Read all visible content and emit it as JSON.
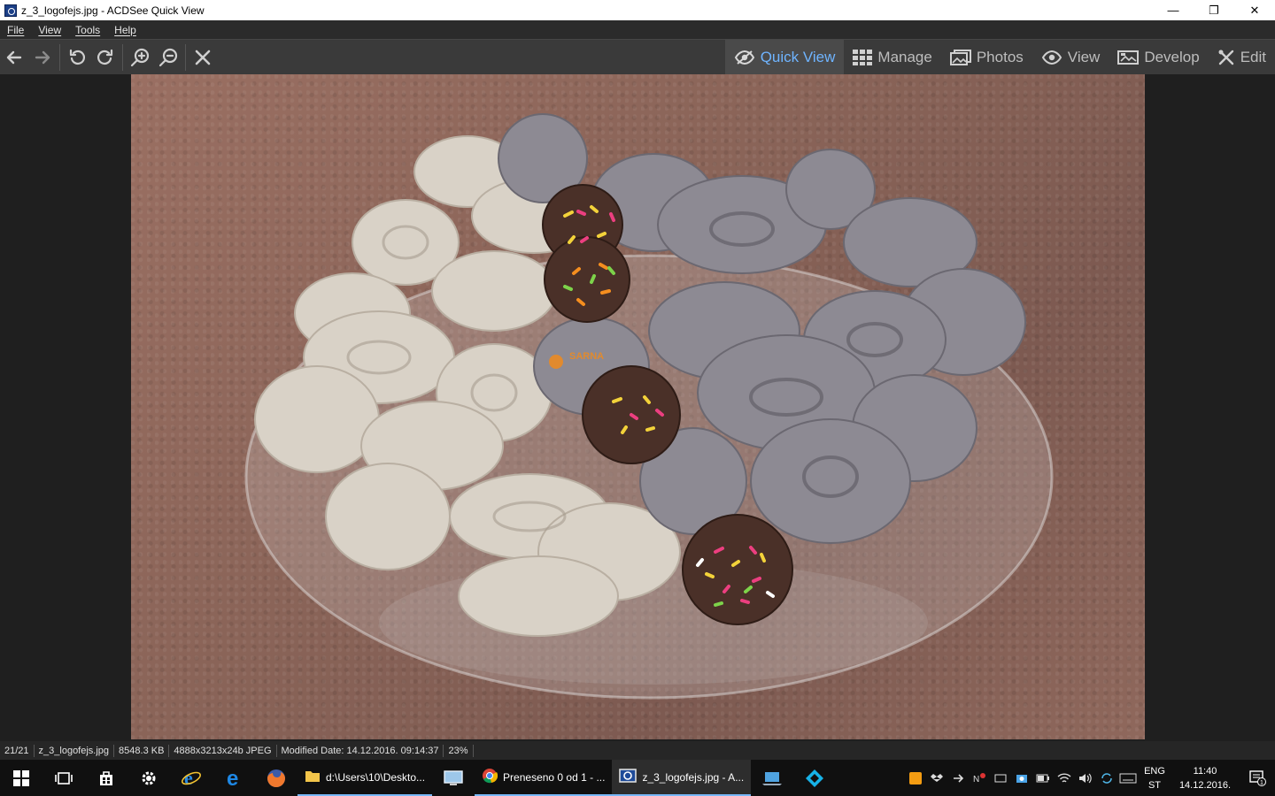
{
  "window": {
    "title": "z_3_logofejs.jpg - ACDSee Quick View",
    "controls": {
      "minimize": "—",
      "restore": "❐",
      "close": "✕"
    }
  },
  "menu": [
    "File",
    "View",
    "Tools",
    "Help"
  ],
  "toolbar": {
    "left_icons": [
      "back-arrow-icon",
      "forward-arrow-icon",
      "rotate-left-icon",
      "rotate-right-icon",
      "zoom-in-icon",
      "zoom-out-icon",
      "close-icon"
    ],
    "modes": [
      {
        "label": "Quick View",
        "icon": "eye-icon",
        "active": true
      },
      {
        "label": "Manage",
        "icon": "grid-icon",
        "active": false
      },
      {
        "label": "Photos",
        "icon": "photos-icon",
        "active": false
      },
      {
        "label": "View",
        "icon": "eye-icon",
        "active": false
      },
      {
        "label": "Develop",
        "icon": "develop-icon",
        "active": false
      },
      {
        "label": "Edit",
        "icon": "edit-icon",
        "active": false
      }
    ]
  },
  "image": {
    "description_icon": "cookie-plate-photo",
    "watermark": "SARNA"
  },
  "status": {
    "index": "21/21",
    "filename": "z_3_logofejs.jpg",
    "filesize": "8548.3 KB",
    "dimensions": "4888x3213x24b JPEG",
    "modified": "Modified Date: 14.12.2016. 09:14:37",
    "zoom": "23%"
  },
  "taskbar": {
    "tasks": [
      {
        "label": "d:\\Users\\10\\Deskto...",
        "icon": "folder-icon",
        "active": false
      },
      {
        "label": "Preneseno 0 od 1 - ...",
        "icon": "chrome-icon",
        "active": false
      },
      {
        "label": "z_3_logofejs.jpg - A...",
        "icon": "acdsee-icon",
        "active": true
      }
    ],
    "language": [
      "ENG",
      "ST"
    ],
    "time": "11:40",
    "date": "14.12.2016.",
    "notification_count": "1"
  },
  "colors": {
    "accent": "#6fb4ff",
    "taskbar_underline": "#77b7f7",
    "toolbar_bg": "#3a3a3a"
  }
}
